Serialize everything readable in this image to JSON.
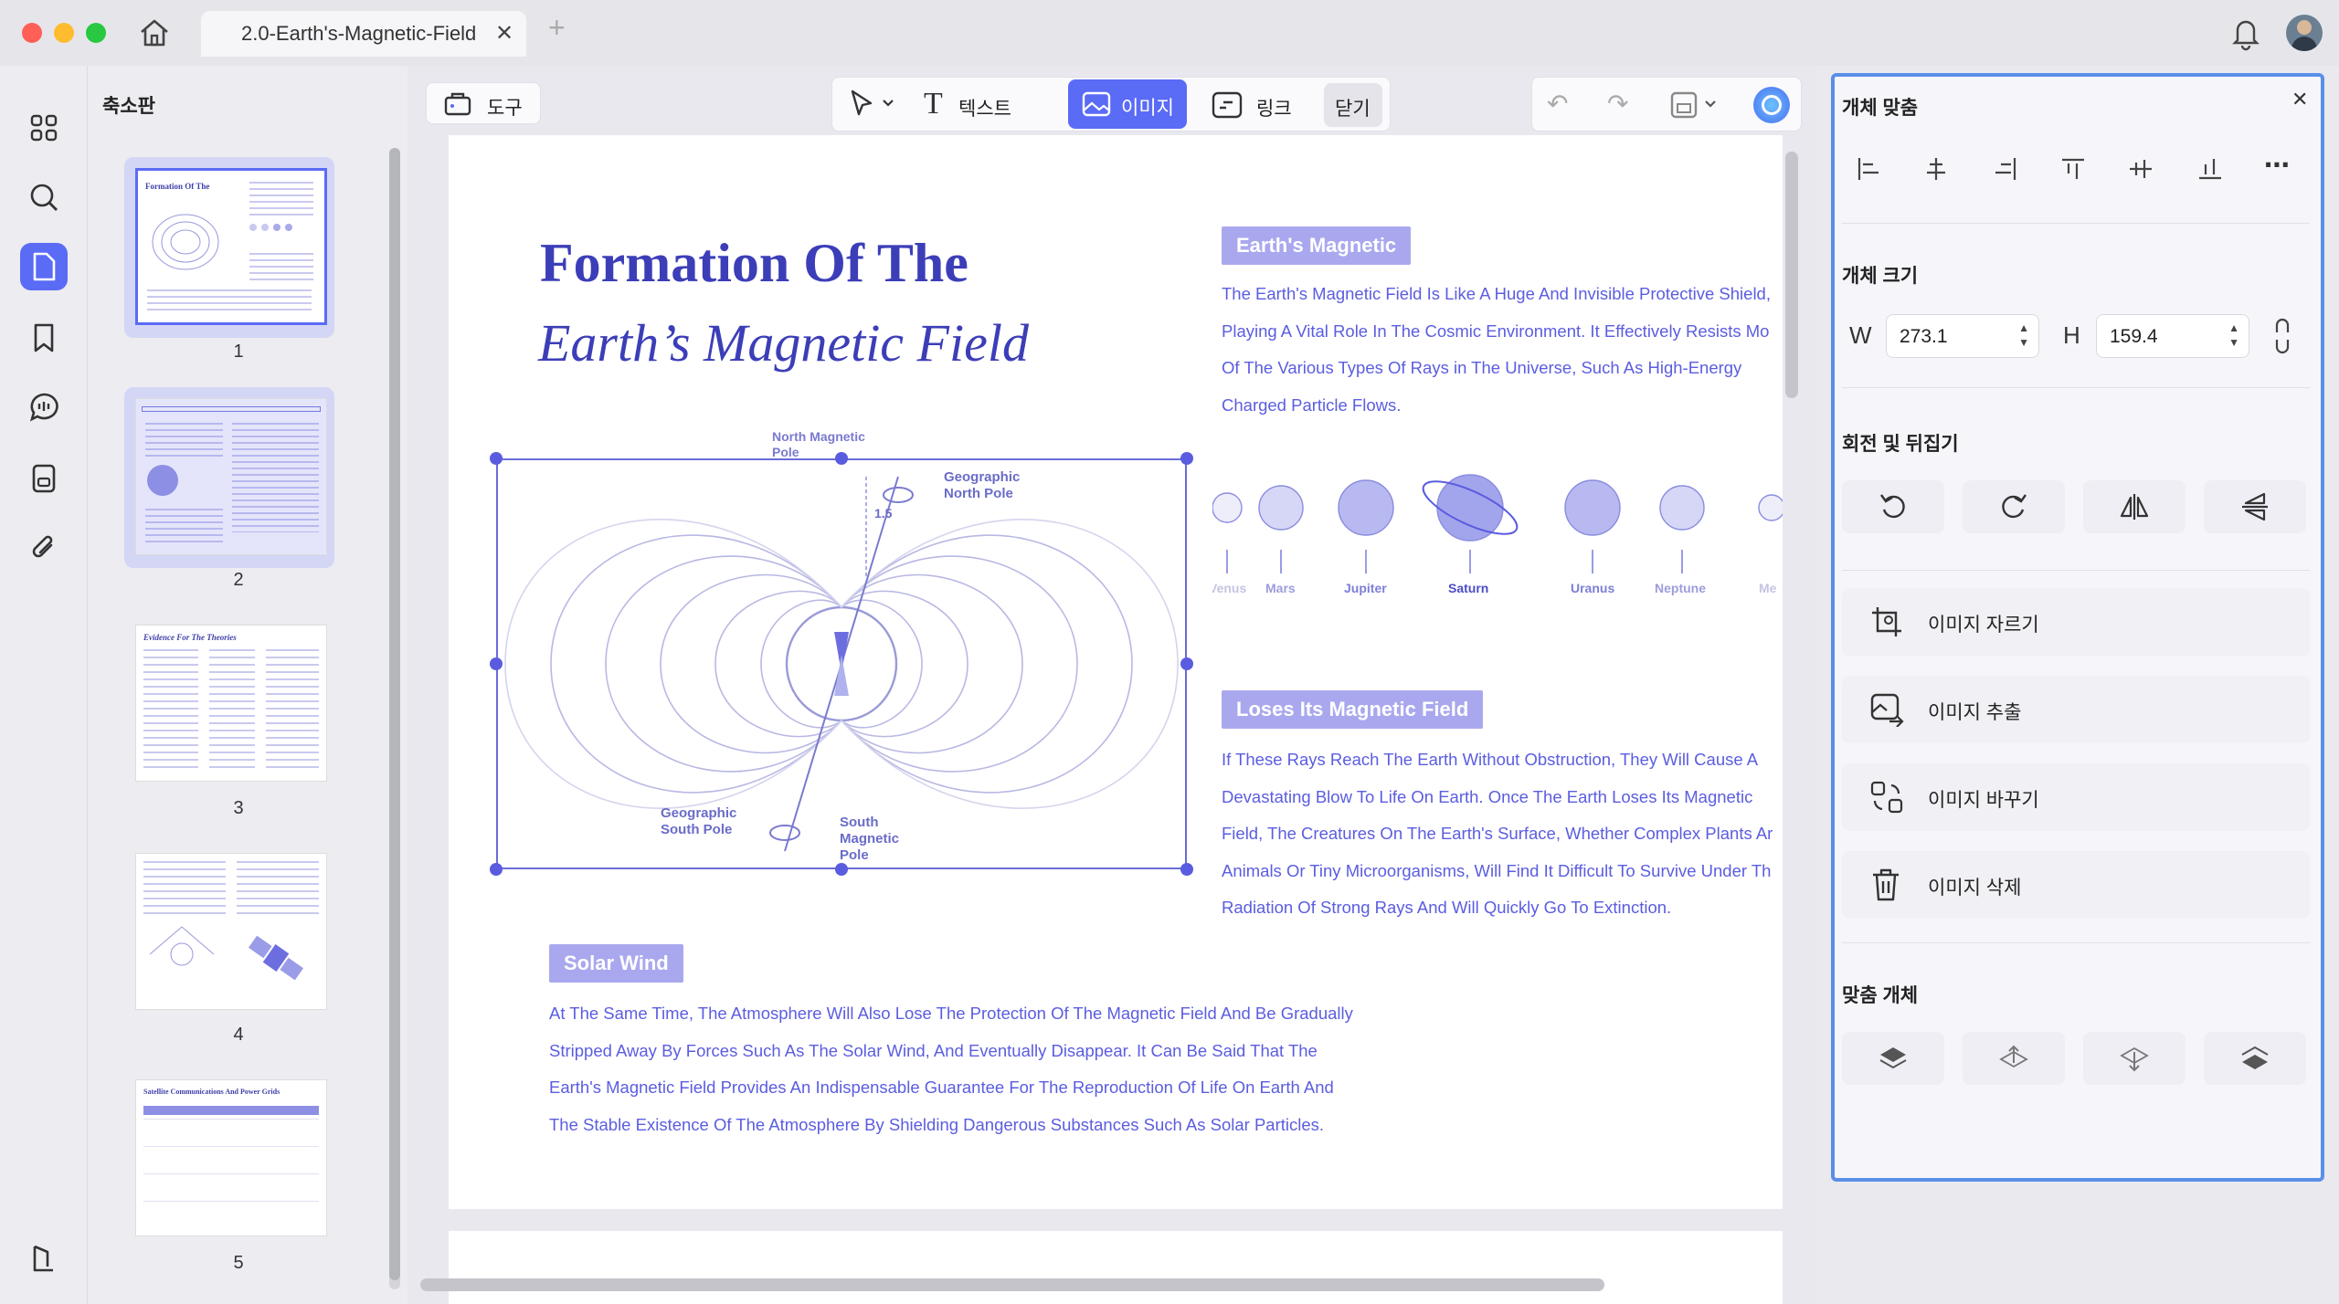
{
  "window": {
    "tab_title": "2.0-Earth's-Magnetic-Field"
  },
  "left_rail": {
    "items": [
      "grid-icon",
      "search-icon",
      "pages-icon",
      "bookmark-icon",
      "comment-icon",
      "form-icon",
      "attachment-icon",
      "layers-icon"
    ]
  },
  "thumbnails": {
    "title": "축소판",
    "pages": [
      "1",
      "2",
      "3",
      "4",
      "5"
    ],
    "previews": [
      "Formation Of The",
      "Evidence For The Theories",
      "Satellite Communications And Power Grids"
    ]
  },
  "toolbar": {
    "tools_label": "도구",
    "text_label": "텍스트",
    "image_label": "이미지",
    "link_label": "링크",
    "close_label": "닫기"
  },
  "document": {
    "title_line1": "Formation Of The",
    "title_line2": "Earth’s Magnetic Field",
    "section1_heading": "Earth's Magnetic",
    "section1_lines": [
      "The Earth's Magnetic Field Is Like A Huge And Invisible Protective Shield,",
      "Playing A Vital Role In The Cosmic Environment. It Effectively Resists Mo",
      "Of The Various Types Of Rays in The Universe, Such As High-Energy",
      "Charged Particle Flows."
    ],
    "planets": [
      "Venus",
      "Mars",
      "Jupiter",
      "Saturn",
      "Uranus",
      "Neptune",
      "Me"
    ],
    "section2_heading": "Loses Its Magnetic Field",
    "section2_lines": [
      "If These Rays Reach The Earth Without Obstruction, They Will Cause A",
      "Devastating Blow To Life On Earth. Once The Earth Loses Its Magnetic",
      "Field, The Creatures On The Earth's Surface, Whether Complex Plants Ar",
      "Animals Or Tiny Microorganisms, Will Find It Difficult To Survive Under Th",
      "Radiation Of Strong Rays And Will Quickly Go To Extinction."
    ],
    "section3_heading": "Solar Wind",
    "section3_lines": [
      "At The Same Time, The Atmosphere Will Also Lose The Protection Of The Magnetic Field And Be Gradually",
      "Stripped Away By Forces Such As The Solar Wind, And Eventually Disappear. It Can Be Said That The",
      "Earth's Magnetic Field Provides An Indispensable Guarantee For The Reproduction Of Life On Earth And",
      "The Stable Existence Of The Atmosphere By Shielding Dangerous Substances Such As Solar Particles."
    ],
    "diagram_labels": {
      "north_magnetic": "North Magnetic Pole",
      "geo_north": "Geographic North Pole",
      "angle": "1.5",
      "geo_south": "Geographic South Pole",
      "south_magnetic": "South Magnetic Pole"
    }
  },
  "panel": {
    "align_title": "개체 맞춤",
    "size_title": "개체 크기",
    "w_label": "W",
    "w_value": "273.1",
    "h_label": "H",
    "h_value": "159.4",
    "rotate_title": "회전 및 뒤집기",
    "crop_label": "이미지 자르기",
    "extract_label": "이미지 추출",
    "replace_label": "이미지 바꾸기",
    "delete_label": "이미지 삭제",
    "arrange_title": "맞춤 개체"
  },
  "colors": {
    "accent": "#5a5ce0",
    "panel_border": "#5a8fe8",
    "heading_bg": "#a9a8ee"
  }
}
